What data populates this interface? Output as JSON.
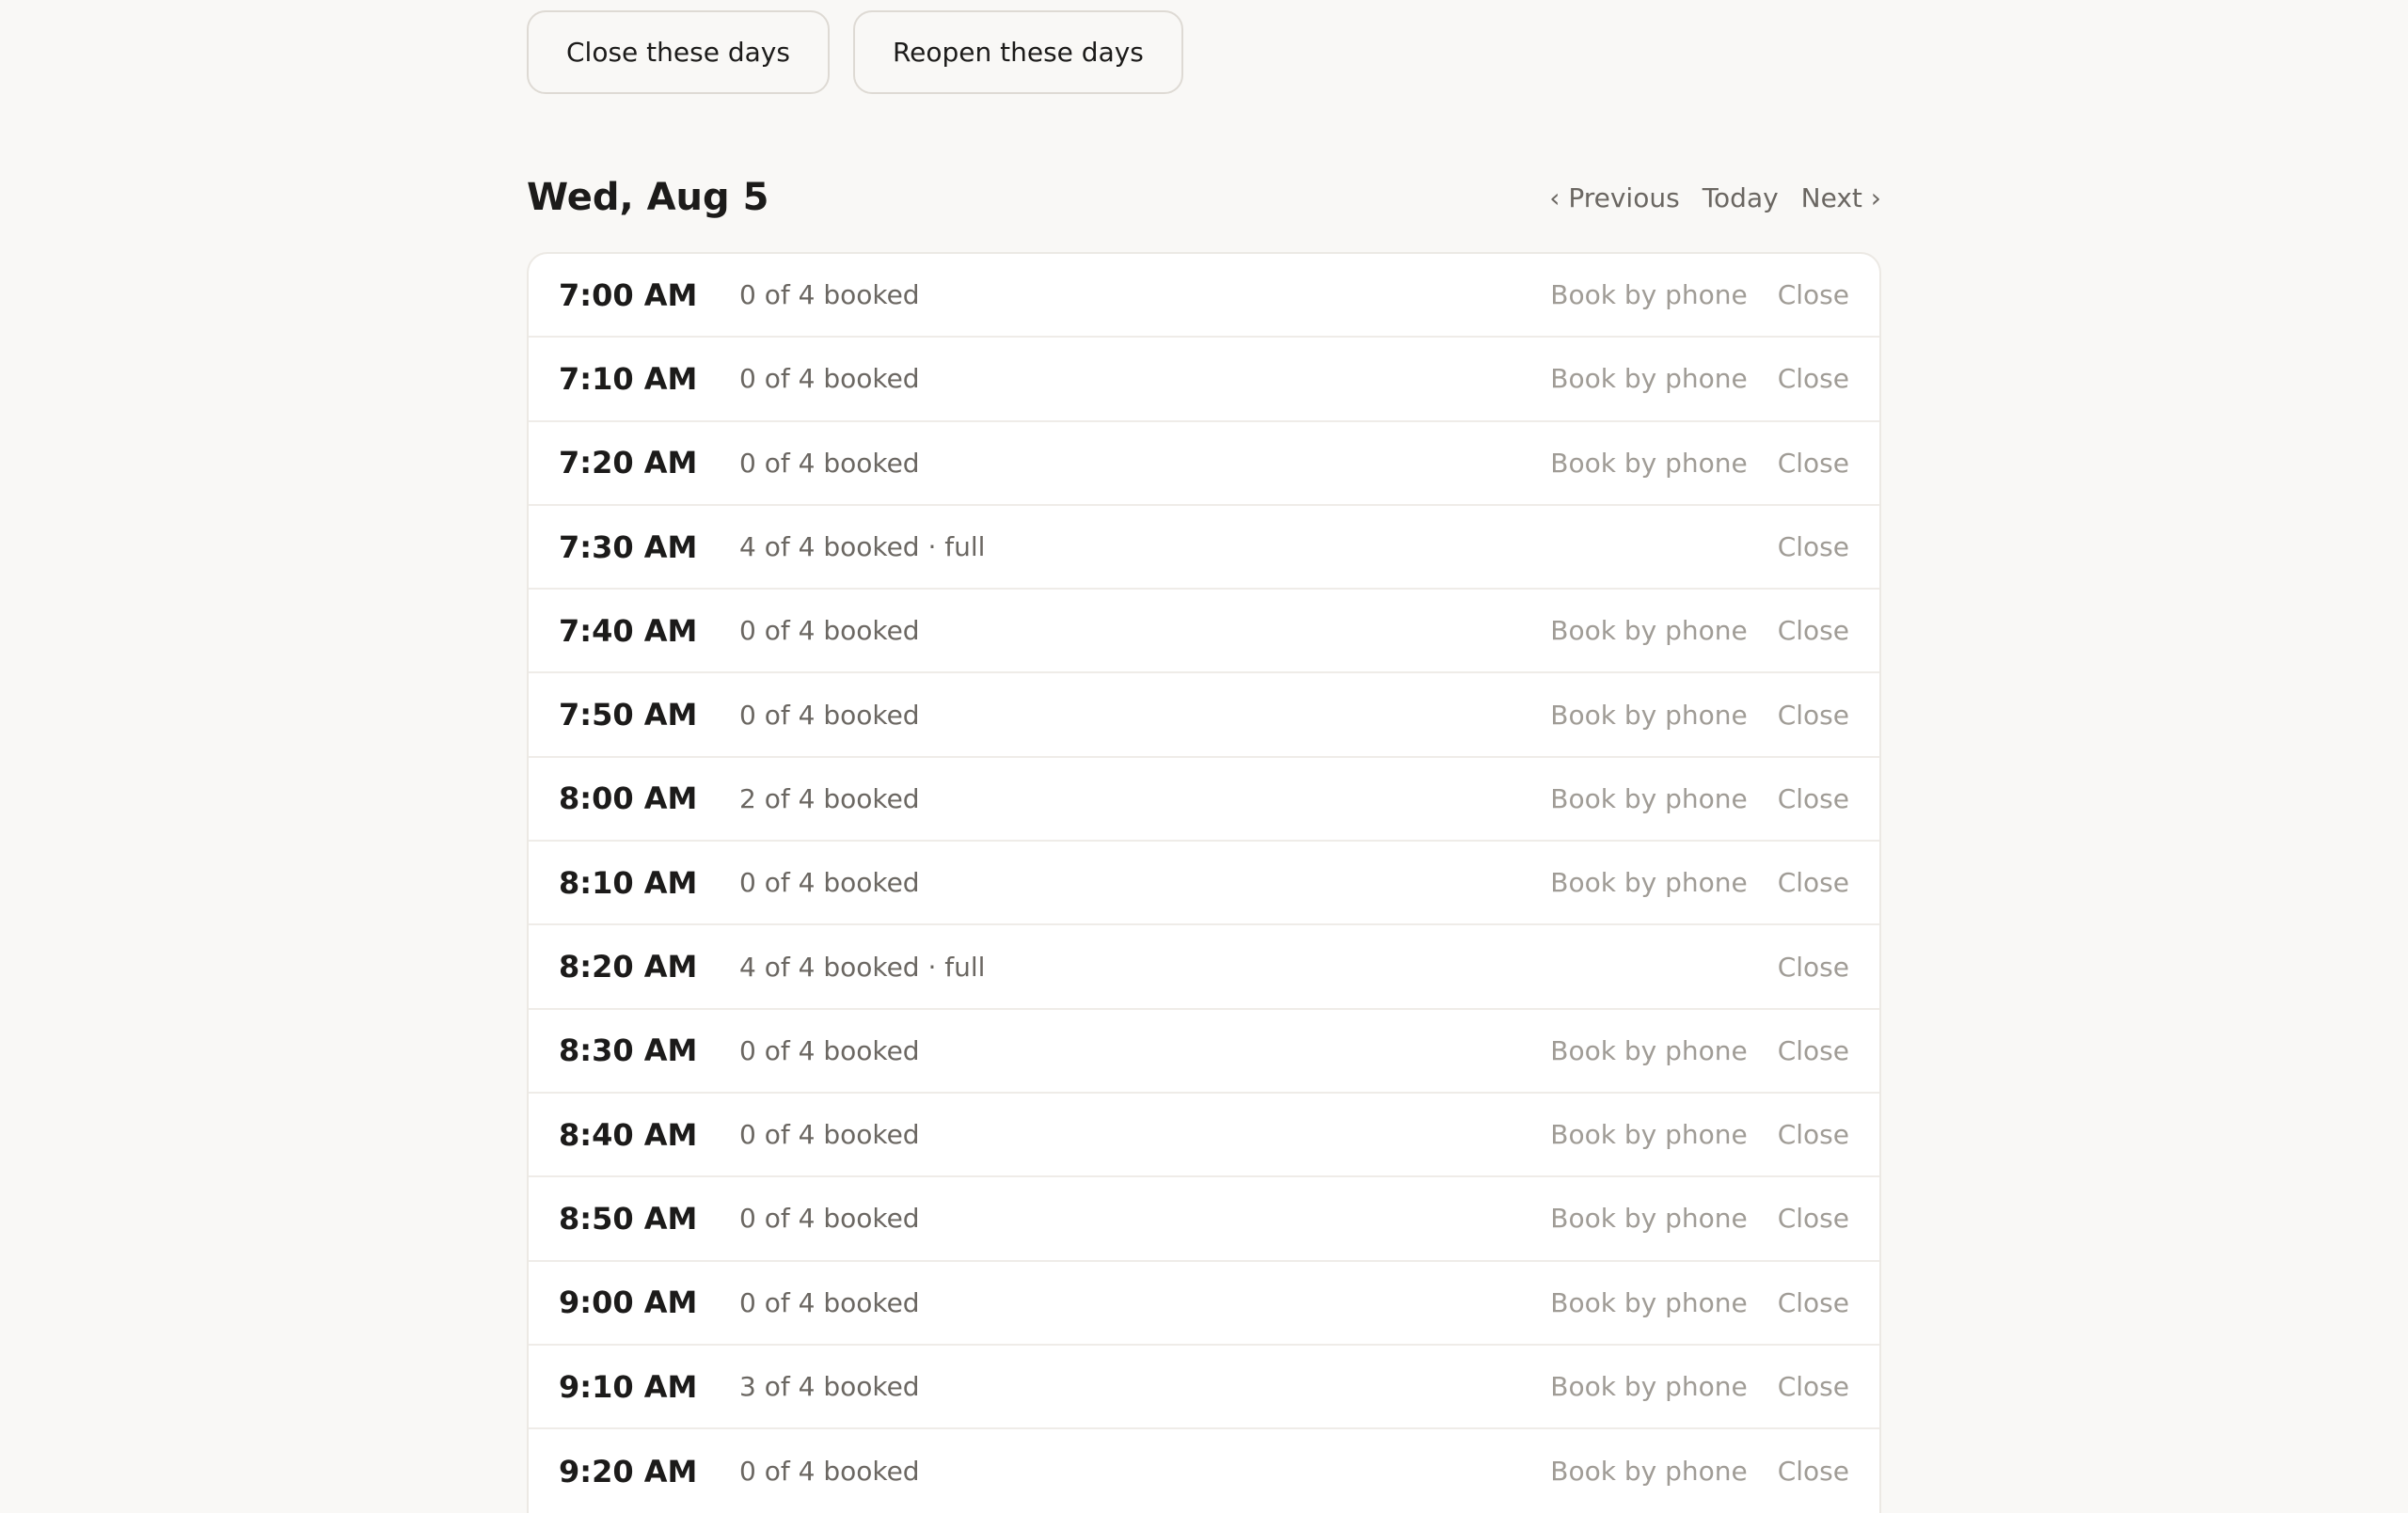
{
  "actions": {
    "close_label": "Close these days",
    "reopen_label": "Reopen these days"
  },
  "day": {
    "title": "Wed, Aug 5",
    "nav": {
      "previous": "‹ Previous",
      "today": "Today",
      "next": "Next ›"
    }
  },
  "slots": [
    {
      "time": "7:00 AM",
      "status": "0 of 4 booked",
      "book": "Book by phone",
      "close": "Close"
    },
    {
      "time": "7:10 AM",
      "status": "0 of 4 booked",
      "book": "Book by phone",
      "close": "Close"
    },
    {
      "time": "7:20 AM",
      "status": "0 of 4 booked",
      "book": "Book by phone",
      "close": "Close"
    },
    {
      "time": "7:30 AM",
      "status": "4 of 4 booked · full",
      "book": "",
      "close": "Close"
    },
    {
      "time": "7:40 AM",
      "status": "0 of 4 booked",
      "book": "Book by phone",
      "close": "Close"
    },
    {
      "time": "7:50 AM",
      "status": "0 of 4 booked",
      "book": "Book by phone",
      "close": "Close"
    },
    {
      "time": "8:00 AM",
      "status": "2 of 4 booked",
      "book": "Book by phone",
      "close": "Close"
    },
    {
      "time": "8:10 AM",
      "status": "0 of 4 booked",
      "book": "Book by phone",
      "close": "Close"
    },
    {
      "time": "8:20 AM",
      "status": "4 of 4 booked · full",
      "book": "",
      "close": "Close"
    },
    {
      "time": "8:30 AM",
      "status": "0 of 4 booked",
      "book": "Book by phone",
      "close": "Close"
    },
    {
      "time": "8:40 AM",
      "status": "0 of 4 booked",
      "book": "Book by phone",
      "close": "Close"
    },
    {
      "time": "8:50 AM",
      "status": "0 of 4 booked",
      "book": "Book by phone",
      "close": "Close"
    },
    {
      "time": "9:00 AM",
      "status": "0 of 4 booked",
      "book": "Book by phone",
      "close": "Close"
    },
    {
      "time": "9:10 AM",
      "status": "3 of 4 booked",
      "book": "Book by phone",
      "close": "Close"
    },
    {
      "time": "9:20 AM",
      "status": "0 of 4 booked",
      "book": "Book by phone",
      "close": "Close"
    }
  ]
}
